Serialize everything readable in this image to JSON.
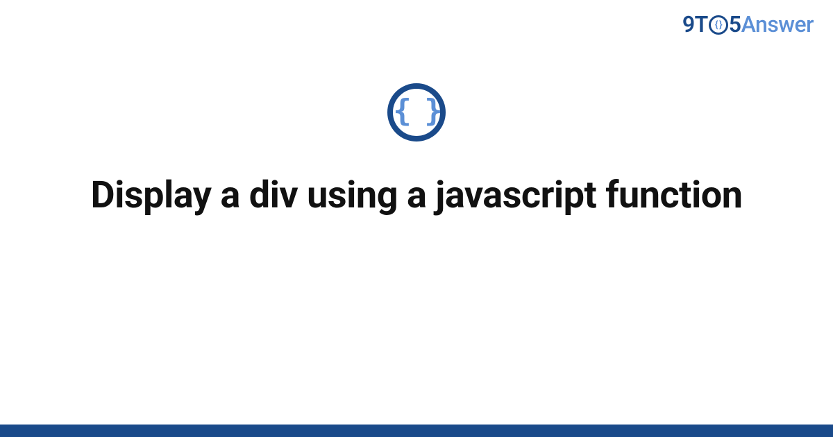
{
  "brand": {
    "nine": "9",
    "t": "T",
    "o_inner": "{ }",
    "five": "5",
    "answer": "Answer"
  },
  "icon": {
    "braces": "{ }"
  },
  "title": "Display a div using a javascript function",
  "colors": {
    "brand_dark": "#1a4a8a",
    "brand_light": "#5b8fd6",
    "text": "#111111",
    "background": "#ffffff"
  }
}
